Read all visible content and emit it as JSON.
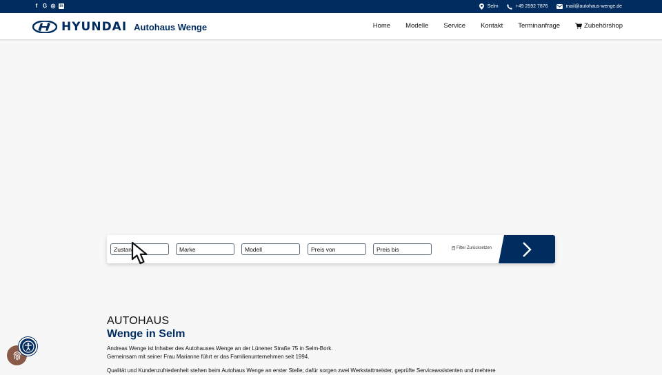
{
  "topbar": {
    "social": [
      {
        "icon": "facebook-icon",
        "glyph": "f"
      },
      {
        "icon": "google-icon",
        "glyph": "G"
      },
      {
        "icon": "instagram-icon",
        "glyph": "◎"
      },
      {
        "icon": "linkedin-icon",
        "glyph": "in"
      }
    ],
    "location": "Selm",
    "phone": "+49 2592 7876",
    "email": "mail@autohaus-wenge.de"
  },
  "header": {
    "brand": "HYUNDAI",
    "dealer": "Autohaus Wenge",
    "nav": [
      "Home",
      "Modelle",
      "Service",
      "Kontakt",
      "Terminanfrage"
    ],
    "shop": "Zubehörshop"
  },
  "filter": {
    "fields": [
      "Zustand",
      "Marke",
      "Modell",
      "Preis von",
      "Preis bis"
    ],
    "reset": "Filter Zurücksetzen"
  },
  "intro": {
    "kicker": "AUTOHAUS",
    "title": "Wenge in Selm",
    "p1_line1": "Andreas Wenge ist Inhaber des Autohauses Wenge an der Lünener Straße 75 in Selm-Bork.",
    "p1_line2": "Gemeinsam mit seiner Frau Marianne führt er das Familienunternehmen seit 1994.",
    "p2": "Qualität und Kundenzufriedenheit stehen beim Autohaus Wenge an erster Stelle;  dafür sorgen zwei Werkstattmeister, geprüfte Serviceassistenten und mehrere"
  },
  "colors": {
    "brand_navy": "#002c5f",
    "fingerprint_badge": "#8a5a48"
  }
}
